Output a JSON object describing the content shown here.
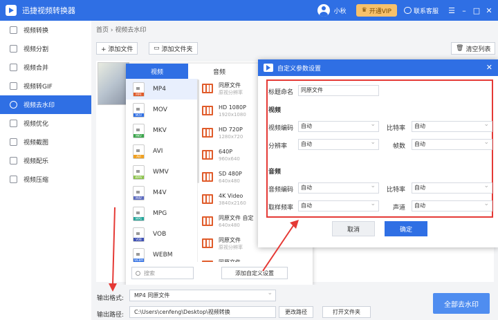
{
  "app": {
    "title": "迅捷视频转换器",
    "username": "小秋",
    "vip_label": "开通VIP",
    "support_label": "联系客服",
    "accent": "#2f6fe4"
  },
  "window_controls": [
    "menu-icon",
    "minimize-icon",
    "maximize-icon",
    "close-icon"
  ],
  "sidebar": {
    "items": [
      {
        "label": "视频转换",
        "icon": "convert-icon"
      },
      {
        "label": "视频分割",
        "icon": "split-icon"
      },
      {
        "label": "视频合并",
        "icon": "merge-icon"
      },
      {
        "label": "视频转GIF",
        "icon": "gif-icon"
      },
      {
        "label": "视频去水印",
        "icon": "watermark-icon",
        "active": true
      },
      {
        "label": "视频优化",
        "icon": "optimize-icon"
      },
      {
        "label": "视频截图",
        "icon": "screenshot-icon"
      },
      {
        "label": "视频配乐",
        "icon": "music-icon"
      },
      {
        "label": "视频压缩",
        "icon": "compress-icon"
      }
    ]
  },
  "main": {
    "breadcrumb": "首页 › 视频去水印",
    "add_file": "+ 添加文件",
    "add_folder": "添加文件夹",
    "clear_list": "清空列表"
  },
  "format_panel": {
    "tabs": [
      "视频",
      "音频"
    ],
    "formats": [
      {
        "name": "MP4",
        "color": "#e05b2a",
        "selected": true
      },
      {
        "name": "MOV",
        "color": "#2f6fe4"
      },
      {
        "name": "MKV",
        "color": "#3aa64b"
      },
      {
        "name": "AVI",
        "color": "#f0a020"
      },
      {
        "name": "WMV",
        "color": "#8bc34a"
      },
      {
        "name": "M4V",
        "color": "#5c6bc0"
      },
      {
        "name": "MPG",
        "color": "#26a69a"
      },
      {
        "name": "VOB",
        "color": "#3f51b5"
      },
      {
        "name": "WEBM",
        "color": "#2f6fe4"
      }
    ],
    "resolutions": [
      {
        "name": "同原文件",
        "sub": "原视分辨率"
      },
      {
        "name": "HD 1080P",
        "sub": "1920x1080"
      },
      {
        "name": "HD 720P",
        "sub": "1280x720"
      },
      {
        "name": "640P",
        "sub": "960x640"
      },
      {
        "name": "SD 480P",
        "sub": "640x480"
      },
      {
        "name": "4K Video",
        "sub": "3840x2160"
      },
      {
        "name": "同原文件 自定",
        "sub": "640x480"
      },
      {
        "name": "同原文件",
        "sub": "原视分辨率"
      },
      {
        "name": "同原文件",
        "sub": "原视分辨率"
      }
    ],
    "search_placeholder": "搜索",
    "add_custom": "添加自定义设置"
  },
  "dialog": {
    "title": "自定义参数设置",
    "name_label": "标题命名",
    "name_value": "同原文件",
    "video_section": "视频",
    "audio_section": "音频",
    "video_codec_label": "视频编码",
    "video_codec": "自动",
    "video_bitrate_label": "比特率",
    "video_bitrate": "自动",
    "resolution_label": "分辨率",
    "resolution": "自动",
    "framerate_label": "帧数",
    "framerate": "自动",
    "audio_codec_label": "音频编码",
    "audio_codec": "自动",
    "audio_bitrate_label": "比特率",
    "audio_bitrate": "自动",
    "samplerate_label": "取样频率",
    "samplerate": "自动",
    "channels_label": "声道",
    "channels": "自动",
    "cancel": "取消",
    "ok": "确定"
  },
  "bottom": {
    "format_label": "输出格式:",
    "format_value": "MP4  同原文件",
    "path_label": "输出路径:",
    "path_value": "C:\\Users\\cenfeng\\Desktop\\视频转换",
    "change_path": "更改路径",
    "open_folder": "打开文件夹",
    "start_button": "全部去水印"
  },
  "annotation_color": "#e53935"
}
